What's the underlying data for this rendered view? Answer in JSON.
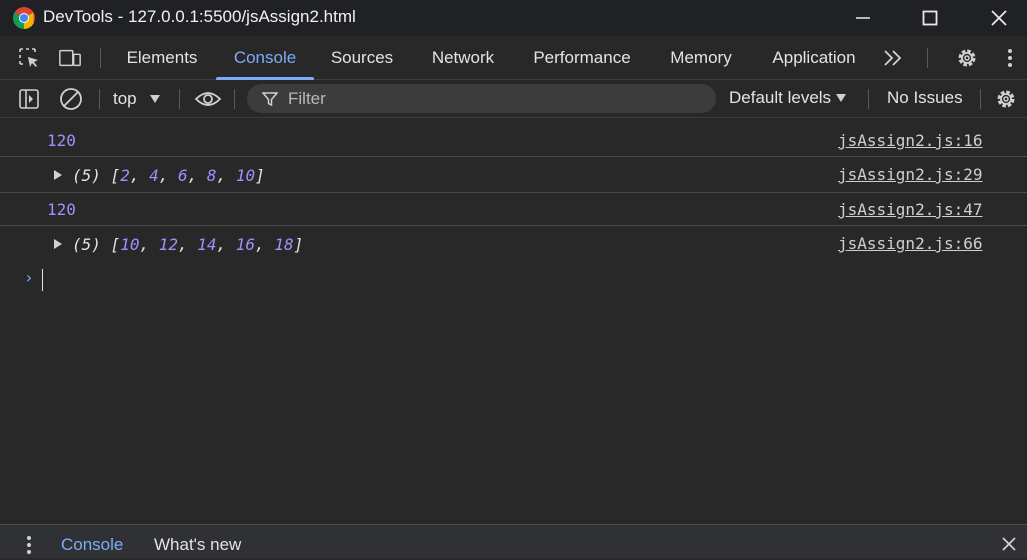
{
  "window": {
    "title": "DevTools - 127.0.0.1:5500/jsAssign2.html"
  },
  "tabs": [
    {
      "label": "Elements"
    },
    {
      "label": "Console"
    },
    {
      "label": "Sources"
    },
    {
      "label": "Network"
    },
    {
      "label": "Performance"
    },
    {
      "label": "Memory"
    },
    {
      "label": "Application"
    }
  ],
  "active_tab": "Console",
  "console_toolbar": {
    "context": "top",
    "filter_placeholder": "Filter",
    "levels": "Default levels",
    "issues": "No Issues"
  },
  "messages": [
    {
      "kind": "number",
      "value": "120",
      "source": "jsAssign2.js:16"
    },
    {
      "kind": "array",
      "length": "(5)",
      "items": [
        "2",
        "4",
        "6",
        "8",
        "10"
      ],
      "source": "jsAssign2.js:29"
    },
    {
      "kind": "number",
      "value": "120",
      "source": "jsAssign2.js:47"
    },
    {
      "kind": "array",
      "length": "(5)",
      "items": [
        "10",
        "12",
        "14",
        "16",
        "18"
      ],
      "source": "jsAssign2.js:66"
    }
  ],
  "drawer": {
    "tabs": [
      {
        "label": "Console"
      },
      {
        "label": "What's new"
      }
    ]
  },
  "colors": {
    "accent": "#7cacf8",
    "number": "#9e91ff",
    "background": "#282828"
  }
}
